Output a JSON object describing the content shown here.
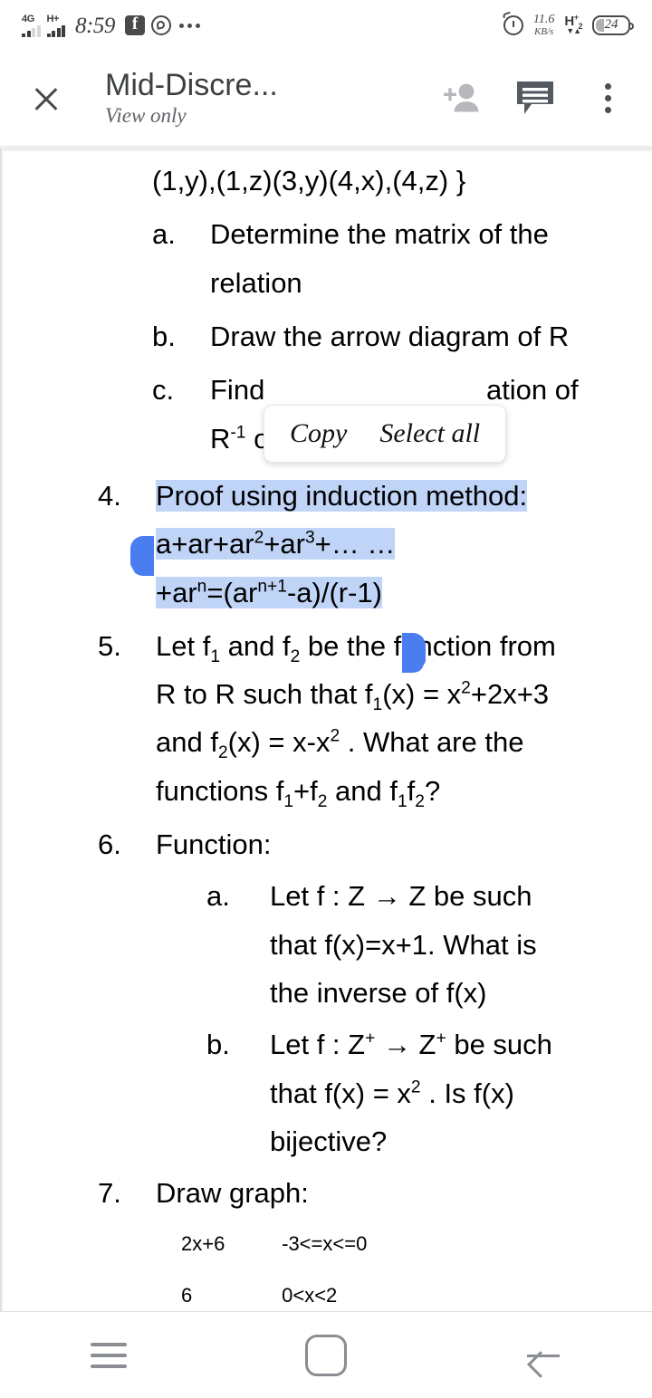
{
  "status_bar": {
    "sim1_network": "4G",
    "sim2_network": "H+",
    "time": "8:59",
    "apps": [
      "facebook-icon",
      "whatsapp-icon",
      "more-notifications-icon"
    ],
    "alarm": "alarm-icon",
    "data_speed_value": "11.6",
    "data_speed_unit": "KB/s",
    "sim2_badge_letter": "H",
    "sim2_badge_sup": "+",
    "sim2_badge_sub": "2",
    "battery_percent": "24"
  },
  "app_bar": {
    "close_icon": "close-icon",
    "title": "Mid-Discre...",
    "subtitle": "View only",
    "add_person_icon": "add-person-icon",
    "comment_icon": "comment-icon",
    "overflow_icon": "overflow-menu-icon"
  },
  "context_menu": {
    "copy_label": "Copy",
    "select_all_label": "Select all"
  },
  "colors": {
    "selection_highlight": "#bfd4f6",
    "selection_handle": "#4a7df0",
    "title_text": "#3c4043",
    "subtitle_text": "#5f6368",
    "nav_icon": "#8a8d91"
  },
  "document": {
    "pair_line": "(1,y),(1,z)(3,y)(4,x),(4,z) }",
    "sub_items_3": [
      {
        "marker": "a.",
        "text": "Determine the matrix of the relation"
      },
      {
        "marker": "b.",
        "text": "Draw the arrow diagram of R"
      },
      {
        "marker": "c.",
        "text_prefix": "Find",
        "text_suffix": "ation of",
        "text_line2_prefix": "R",
        "text_line2_sup": "-1",
        "text_line2_suffix": "o..."
      }
    ],
    "item4": {
      "marker": "4.",
      "line1": "Proof using induction method:",
      "line2_a": "a+ar+ar",
      "line2_sup1": "2",
      "line2_b": "+ar",
      "line2_sup2": "3",
      "line2_c": "+… …",
      "line3_a": "+ar",
      "line3_sup1": "n",
      "line3_b": "=(ar",
      "line3_sup2": "n+1",
      "line3_c": "-a)/(r-1)"
    },
    "item5": {
      "marker": "5.",
      "l1_a": "Let f",
      "l1_sub1": "1",
      "l1_b": " and f",
      "l1_sub2": "2",
      "l1_c": " be the function from",
      "l2_a": "R to R such that f",
      "l2_sub1": "1",
      "l2_b": "(x) = x",
      "l2_sup1": "2",
      "l2_c": "+2x+3",
      "l3_a": "and f",
      "l3_sub1": "2",
      "l3_b": "(x) = x-x",
      "l3_sup1": "2",
      "l3_c": " . What are the",
      "l4_a": "functions f",
      "l4_sub1": "1",
      "l4_b": "+f",
      "l4_sub2": "2",
      "l4_c": " and f",
      "l4_sub3": "1",
      "l4_d": "f",
      "l4_sub4": "2",
      "l4_e": "?"
    },
    "item6": {
      "marker": "6.",
      "title": "Function:",
      "sub_a": {
        "marker": "a.",
        "l1": "Let f : Z → Z be such",
        "l2": "that f(x)=x+1. What is",
        "l3": "the inverse of f(x)"
      },
      "sub_b": {
        "marker": "b.",
        "l1_a": "Let f : Z",
        "l1_sup1": "+",
        "l1_b": " → Z",
        "l1_sup2": "+",
        "l1_c": " be such",
        "l2_a": "that f(x) = x",
        "l2_sup1": "2",
        "l2_b": " . Is f(x)",
        "l3": "bijective?"
      }
    },
    "item7": {
      "marker": "7.",
      "title": "Draw graph:",
      "rows": [
        {
          "expr": "2x+6",
          "domain": "-3<=x<=0"
        },
        {
          "expr": "6",
          "domain": "0<x<2"
        }
      ]
    }
  },
  "nav_bar": {
    "recents_icon": "recents-menu-icon",
    "home_icon": "home-icon",
    "back_icon": "back-arrow-icon"
  }
}
